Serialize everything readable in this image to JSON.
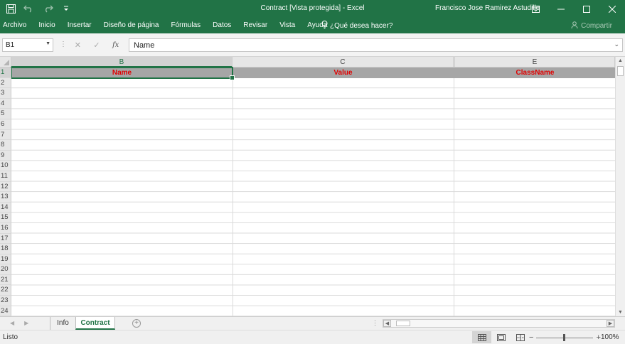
{
  "titlebar": {
    "title": "Contract  [Vista protegida]  -  Excel",
    "user": "Francisco Jose Ramirez Astudillo",
    "qat_icons": [
      "save-icon",
      "undo-icon",
      "redo-icon",
      "customize-icon"
    ],
    "window_controls": [
      "ribbon-display-icon",
      "minimize-icon",
      "maximize-icon",
      "close-icon"
    ]
  },
  "ribbon": {
    "tabs": [
      "Archivo",
      "Inicio",
      "Insertar",
      "Diseño de página",
      "Fórmulas",
      "Datos",
      "Revisar",
      "Vista",
      "Ayuda"
    ],
    "tell_me": "¿Qué desea hacer?",
    "share": "Compartir"
  },
  "formula_bar": {
    "name_box": "B1",
    "formula": "Name"
  },
  "columns": [
    "B",
    "C",
    "E"
  ],
  "rows": [
    "1",
    "2",
    "3",
    "4",
    "5",
    "6",
    "7",
    "8",
    "9",
    "10",
    "11",
    "12",
    "13",
    "14",
    "15",
    "16",
    "17",
    "18",
    "19",
    "20",
    "21",
    "22",
    "23",
    "24"
  ],
  "header_cells": [
    "Name",
    "Value",
    "ClassName"
  ],
  "sheets": {
    "tabs": [
      "Info",
      "Contract"
    ],
    "active": "Contract"
  },
  "status": {
    "text": "Listo",
    "zoom": "100%"
  },
  "colors": {
    "accent": "#217346",
    "header_fill": "#a6a6a6",
    "header_text": "#e00000"
  }
}
